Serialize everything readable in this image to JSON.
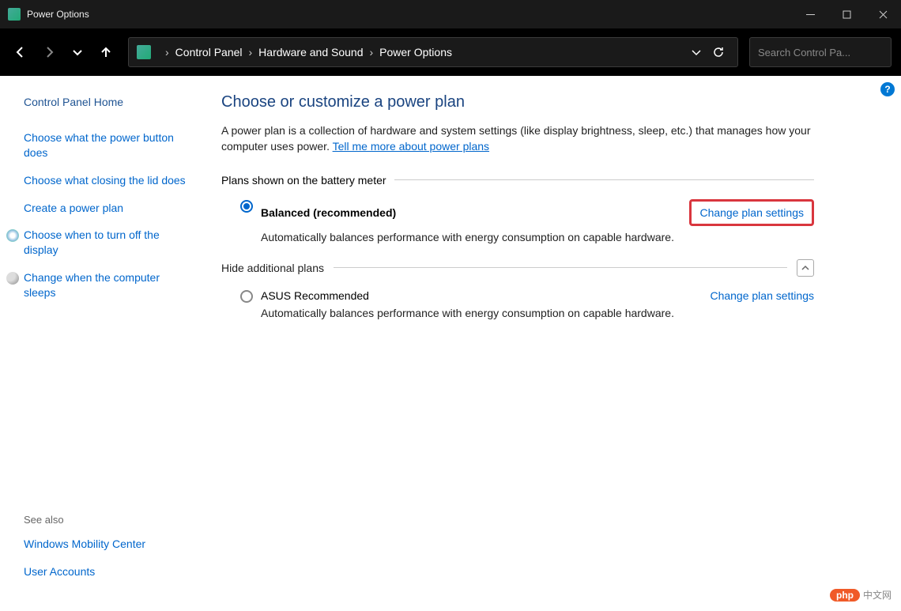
{
  "window": {
    "title": "Power Options"
  },
  "breadcrumbs": {
    "root": "Control Panel",
    "mid": "Hardware and Sound",
    "leaf": "Power Options"
  },
  "search": {
    "placeholder": "Search Control Pa..."
  },
  "sidebar": {
    "home": "Control Panel Home",
    "links": {
      "power_button": "Choose what the power button does",
      "closing_lid": "Choose what closing the lid does",
      "create_plan": "Create a power plan",
      "turn_off_display": "Choose when to turn off the display",
      "computer_sleeps": "Change when the computer sleeps"
    },
    "see_also_label": "See also",
    "see_also": {
      "mobility": "Windows Mobility Center",
      "accounts": "User Accounts"
    }
  },
  "main": {
    "heading": "Choose or customize a power plan",
    "description_pre": "A power plan is a collection of hardware and system settings (like display brightness, sleep, etc.) that manages how your computer uses power. ",
    "description_link": "Tell me more about power plans",
    "section1_label": "Plans shown on the battery meter",
    "section2_label": "Hide additional plans",
    "plans": {
      "balanced": {
        "name": "Balanced (recommended)",
        "desc": "Automatically balances performance with energy consumption on capable hardware.",
        "change_link": "Change plan settings"
      },
      "asus": {
        "name": "ASUS Recommended",
        "desc": "Automatically balances performance with energy consumption on capable hardware.",
        "change_link": "Change plan settings"
      }
    }
  },
  "help_icon_text": "?",
  "watermark": {
    "pill": "php",
    "text": "中文网"
  }
}
